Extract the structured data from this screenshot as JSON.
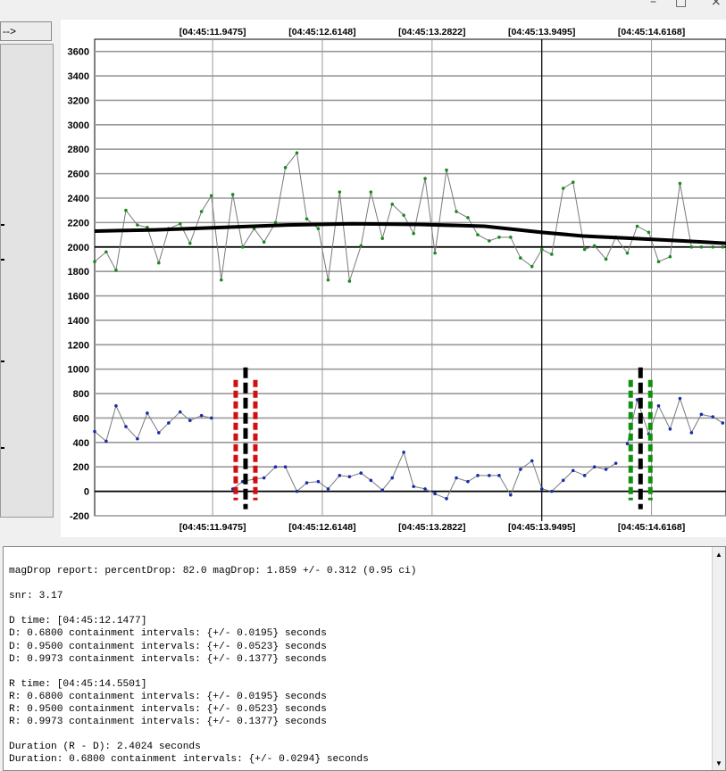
{
  "window": {
    "controls": [
      "–",
      "□",
      "×"
    ]
  },
  "toolbar": {
    "arrow_button_label": "-->"
  },
  "colors": {
    "d_marker": "#d01010",
    "r_marker": "#109010",
    "fit_line": "#000000",
    "series_upper": "#7a7a7a",
    "series_lower": "#7a7a7a"
  },
  "chart_data": {
    "type": "line",
    "ylim": [
      -200,
      3700
    ],
    "yticks": [
      -200,
      0,
      200,
      400,
      600,
      800,
      1000,
      1200,
      1400,
      1600,
      1800,
      2000,
      2200,
      2400,
      2600,
      2800,
      3000,
      3200,
      3400,
      3600
    ],
    "xticks_top": [
      "[04:45:11.9475]",
      "[04:45:12.6148]",
      "[04:45:13.2822]",
      "[04:45:13.9495]",
      "[04:45:14.6168]"
    ],
    "xticks_bottom": [
      "[04:45:11.9475]",
      "[04:45:12.6148]",
      "[04:45:13.2822]",
      "[04:45:13.9495]",
      "[04:45:14.6168]"
    ],
    "xtick_times": [
      11.9475,
      12.6148,
      13.2822,
      13.9495,
      14.6168
    ],
    "xlim": [
      11.23,
      15.07
    ],
    "grid": true,
    "cursor_time": 13.9495,
    "reference_lines": [
      2000,
      0
    ],
    "series": [
      {
        "role": "upper",
        "x": [
          11.23,
          11.3,
          11.36,
          11.42,
          11.49,
          11.55,
          11.62,
          11.68,
          11.75,
          11.81,
          11.88,
          11.94,
          12.0,
          12.07,
          12.13,
          12.2,
          12.26,
          12.33,
          12.39,
          12.46,
          12.52,
          12.59,
          12.65,
          12.72,
          12.78,
          12.85,
          12.91,
          12.98,
          13.04,
          13.11,
          13.17,
          13.24,
          13.3,
          13.37,
          13.43,
          13.5,
          13.56,
          13.63,
          13.69,
          13.76,
          13.82,
          13.89,
          13.95,
          14.01,
          14.08,
          14.14,
          14.21,
          14.27,
          14.34,
          14.4,
          14.47,
          14.53,
          14.6,
          14.66,
          14.73,
          14.79,
          14.86,
          14.92,
          14.99,
          15.05
        ],
        "values": [
          1880,
          1960,
          1810,
          2300,
          2180,
          2160,
          1870,
          2150,
          2190,
          2030,
          2290,
          2420,
          1730,
          2430,
          2000,
          2150,
          2040,
          2200,
          2650,
          2770,
          2230,
          2150,
          1730,
          2450,
          1720,
          2010,
          2450,
          2070,
          2350,
          2260,
          2110,
          2560,
          1950,
          2630,
          2290,
          2240,
          2100,
          2050,
          2080,
          2080,
          1910,
          1840,
          1980,
          1940,
          2480,
          2530,
          1980,
          2010,
          1900,
          2080,
          1950,
          2170,
          2120,
          1880,
          1920,
          2520,
          2000,
          2000,
          2000,
          2000
        ]
      },
      {
        "role": "lower-pre",
        "x": [
          11.23,
          11.3,
          11.36,
          11.42,
          11.49,
          11.55,
          11.62,
          11.68,
          11.75,
          11.81,
          11.88,
          11.94
        ],
        "values": [
          490,
          410,
          700,
          530,
          430,
          640,
          480,
          560,
          650,
          580,
          620,
          600
        ]
      },
      {
        "role": "lower-mid",
        "x": [
          12.07,
          12.13,
          12.2,
          12.26,
          12.33,
          12.39,
          12.46,
          12.52,
          12.59,
          12.65,
          12.72,
          12.78,
          12.85,
          12.91,
          12.98,
          13.04,
          13.11,
          13.17,
          13.24,
          13.3,
          13.37,
          13.43,
          13.5,
          13.56,
          13.63,
          13.69,
          13.76,
          13.82,
          13.89,
          13.95,
          14.01,
          14.08,
          14.14,
          14.21,
          14.27,
          14.34,
          14.4
        ],
        "values": [
          20,
          80,
          100,
          110,
          200,
          200,
          0,
          70,
          80,
          20,
          130,
          120,
          150,
          90,
          10,
          110,
          320,
          40,
          20,
          -20,
          -60,
          110,
          80,
          130,
          130,
          130,
          -30,
          180,
          250,
          20,
          0,
          90,
          170,
          130,
          200,
          180,
          230
        ]
      },
      {
        "role": "lower-post",
        "x": [
          14.47,
          14.53,
          14.6,
          14.66,
          14.73,
          14.79,
          14.86,
          14.92,
          14.99,
          15.05
        ],
        "values": [
          390,
          750,
          470,
          700,
          510,
          760,
          480,
          630,
          610,
          560
        ]
      }
    ],
    "fit_curve": {
      "x": [
        11.23,
        11.6,
        12.0,
        12.4,
        12.8,
        13.2,
        13.6,
        13.95,
        14.2,
        14.5,
        14.8,
        15.07
      ],
      "values": [
        2130,
        2140,
        2160,
        2180,
        2190,
        2185,
        2170,
        2120,
        2090,
        2070,
        2050,
        2030
      ]
    },
    "markers": [
      {
        "label": "D",
        "time": 12.1477,
        "color": "#d01010",
        "ymin": 0,
        "ymax": 1000
      },
      {
        "label": "R",
        "time": 14.5501,
        "color": "#109010",
        "ymin": 0,
        "ymax": 1000
      }
    ]
  },
  "report": {
    "lines": [
      "magDrop report: percentDrop: 82.0 magDrop: 1.859 +/- 0.312 (0.95 ci)",
      "",
      "snr: 3.17",
      "",
      "D time: [04:45:12.1477]",
      "D: 0.6800 containment intervals: {+/- 0.0195} seconds",
      "D: 0.9500 containment intervals: {+/- 0.0523} seconds",
      "D: 0.9973 containment intervals: {+/- 0.1377} seconds",
      "",
      "R time: [04:45:14.5501]",
      "R: 0.6800 containment intervals: {+/- 0.0195} seconds",
      "R: 0.9500 containment intervals: {+/- 0.0523} seconds",
      "R: 0.9973 containment intervals: {+/- 0.1377} seconds",
      "",
      "Duration (R - D): 2.4024 seconds",
      "Duration: 0.6800 containment intervals: {+/- 0.0294} seconds"
    ]
  }
}
